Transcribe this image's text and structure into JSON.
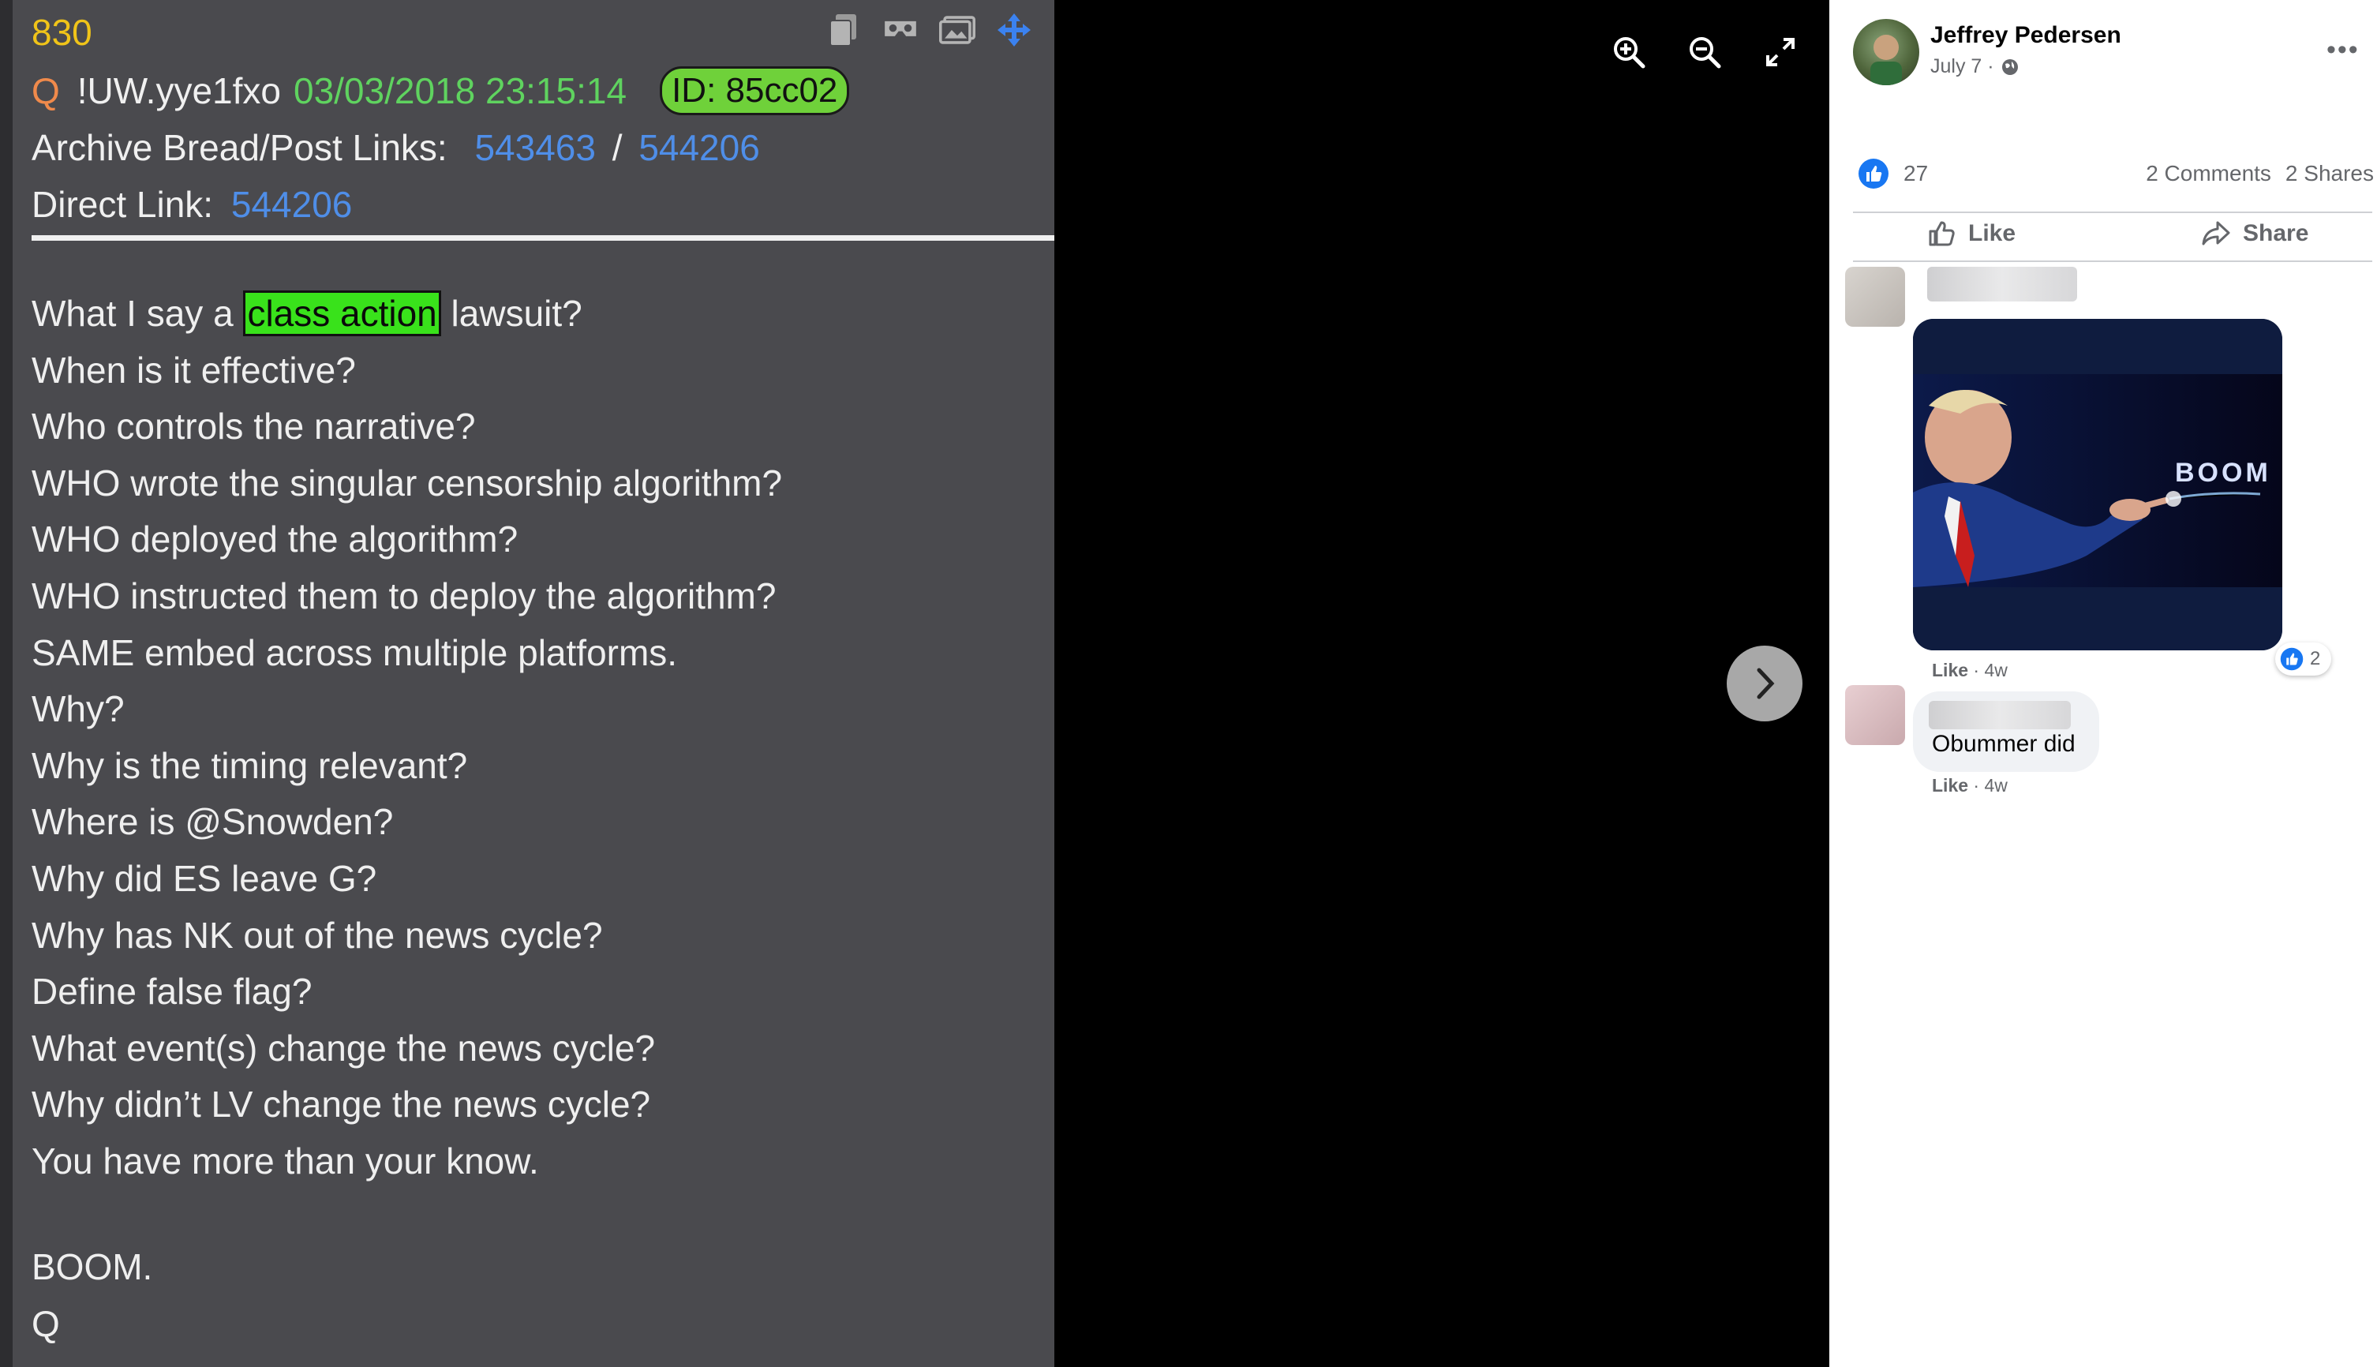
{
  "viewer": {
    "zoom_in": "zoom-in-icon",
    "zoom_out": "zoom-out-icon",
    "fullscreen": "fullscreen-icon",
    "next": "next-arrow-icon"
  },
  "qpost": {
    "number": "830",
    "q": "Q",
    "tripcode": "!UW.yye1fxo",
    "datetime": "03/03/2018 23:15:14",
    "id": "ID: 85cc02",
    "archive_label": "Archive Bread/Post Links:",
    "archive_link1": "543463",
    "archive_slash": "/",
    "archive_link2": "544206",
    "direct_label": "Direct Link:",
    "direct_link": "544206",
    "line1_pre": "What I say a ",
    "line1_highlight": "class action",
    "line1_post": " lawsuit?",
    "lines": [
      "When is it effective?",
      "Who controls the narrative?",
      "WHO wrote the singular censorship algorithm?",
      "WHO deployed the algorithm?",
      "WHO instructed them to deploy the algorithm?",
      "SAME embed across multiple platforms.",
      "Why?",
      "Why is the timing relevant?",
      "Where is @Snowden?",
      "Why did ES leave G?",
      "Why has NK out of the news cycle?",
      "Define false flag?",
      "What event(s) change the news cycle?",
      "Why didn’t LV change the news cycle?",
      "You have more than your know."
    ],
    "boom": "BOOM.",
    "signature": "Q",
    "colors": {
      "background": "#4a4a4e",
      "number": "#f0c419",
      "date": "#5fd35f",
      "link": "#4f8ee8",
      "highlight": "#39e21b"
    }
  },
  "post": {
    "author": "Jeffrey Pedersen",
    "date": "July 7 ·",
    "reaction_count": "27",
    "comments": "2 Comments",
    "shares": "2 Shares",
    "like_label": "Like",
    "share_label": "Share"
  },
  "comments": [
    {
      "image_text": "BOOM",
      "like": "Like",
      "time": "· 4w",
      "reaction_count": "2"
    },
    {
      "text": "Obummer did",
      "like": "Like",
      "time": "· 4w"
    }
  ]
}
